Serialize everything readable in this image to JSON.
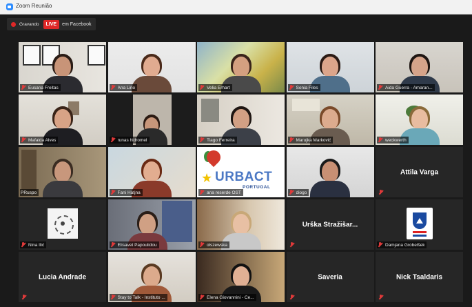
{
  "window": {
    "title": "Zoom Reunião"
  },
  "recording": {
    "status": "Gravando",
    "live_badge": "LIVE",
    "live_target": "em Facebook"
  },
  "tiles": [
    {
      "name": "Eusana Freitas"
    },
    {
      "name": "Ana Lirio"
    },
    {
      "name": "Velia Erhart"
    },
    {
      "name": "Sonia Files"
    },
    {
      "name": "Aida Guerra - Amaran..."
    },
    {
      "name": "Mafalda Alves"
    },
    {
      "name": "runas hidromel"
    },
    {
      "name": "Tiago Ferreira"
    },
    {
      "name": "Marujka Marković"
    },
    {
      "name": "weckwerth"
    },
    {
      "name": "PRuspo"
    },
    {
      "name": "Fani Hatjna"
    },
    {
      "name": "ana reserde OST",
      "logo_text": "URBACT",
      "logo_sub": "PORTUGAL"
    },
    {
      "name": "diogo"
    },
    {
      "display_name": "Attila Varga"
    },
    {
      "name": "Nina Ilić"
    },
    {
      "name": "Elisavet Papoulidou"
    },
    {
      "name": "olszewska"
    },
    {
      "display_name": "Urška Stražišar..."
    },
    {
      "name": "Damjana Grobelšek"
    },
    {
      "display_name": "Lucia Andrade"
    },
    {
      "name": "Stay to Talk - Instituto ..."
    },
    {
      "name": "Elena Giovannini - Ce..."
    },
    {
      "display_name": "Saveria"
    },
    {
      "display_name": "Nick Tsaldaris"
    }
  ]
}
